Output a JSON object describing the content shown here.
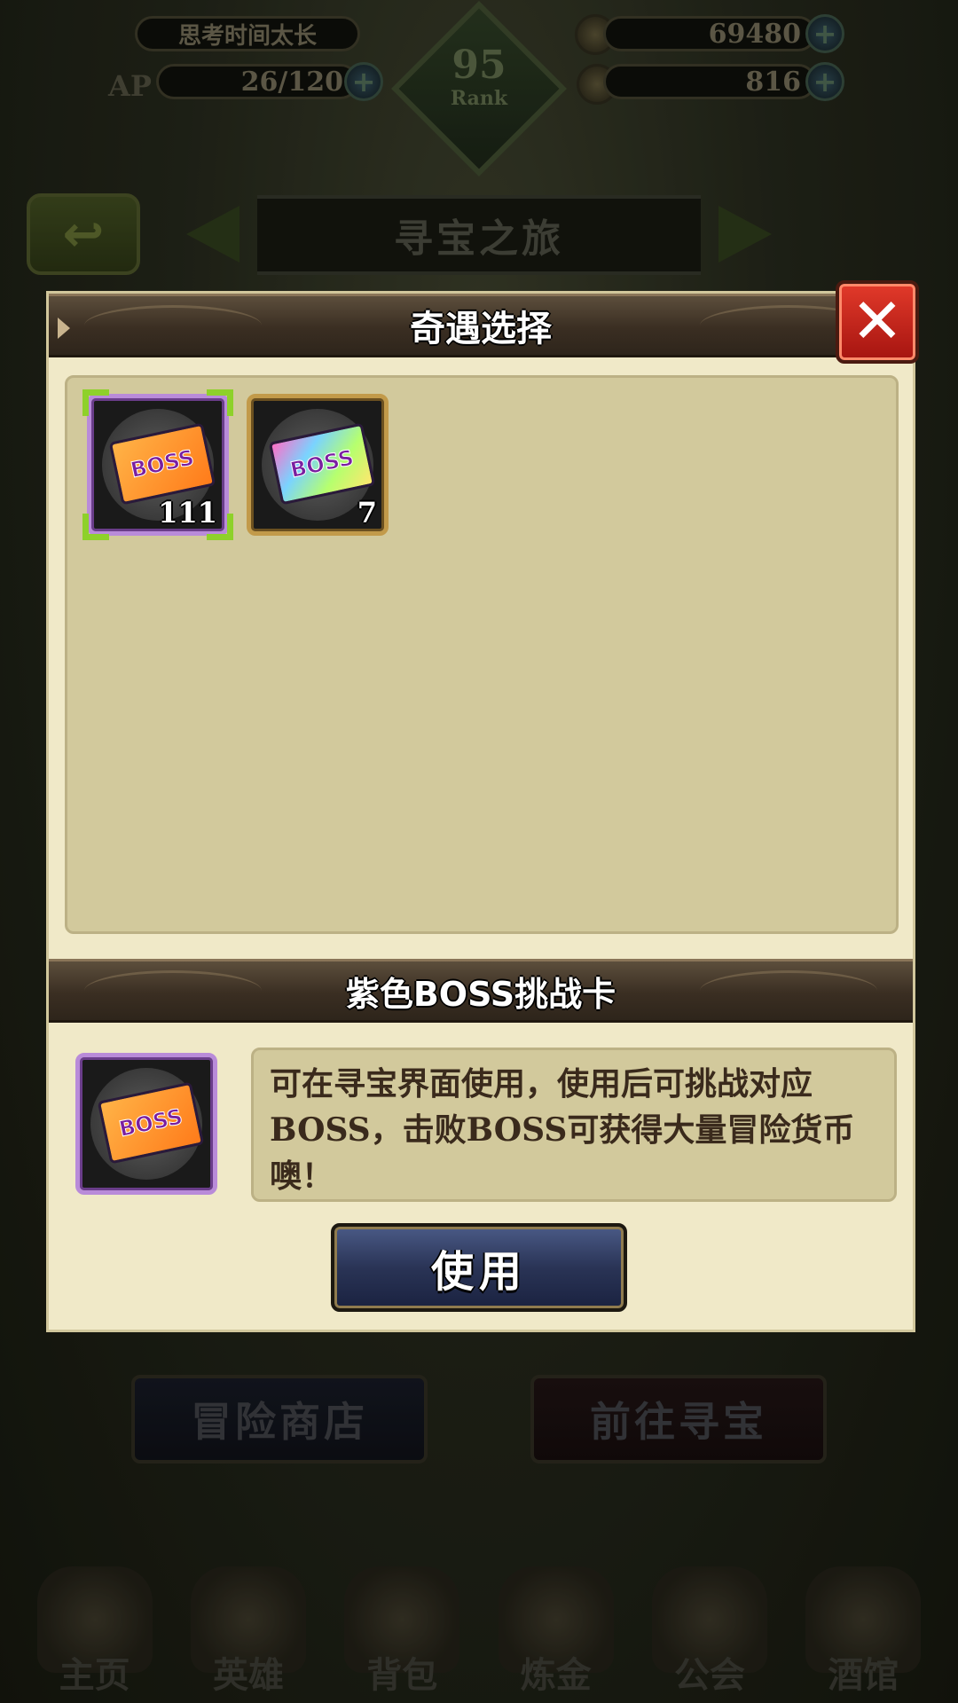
{
  "hud": {
    "status_text": "思考时间太长",
    "ap_label": "AP",
    "ap_value": "26/120",
    "rank_value": "95",
    "rank_label": "Rank",
    "gold_value": "69480",
    "feather_value": "816",
    "plus_symbol": "+"
  },
  "page": {
    "title": "寻宝之旅",
    "back_symbol": "↩"
  },
  "background_buttons": {
    "shop": "冒险商店",
    "go_treasure": "前往寻宝"
  },
  "bottom_nav": {
    "items": [
      {
        "label": "主页",
        "icon": "castle-icon"
      },
      {
        "label": "英雄",
        "icon": "helmet-icon"
      },
      {
        "label": "背包",
        "icon": "backpack-icon"
      },
      {
        "label": "炼金",
        "icon": "potion-icon"
      },
      {
        "label": "公会",
        "icon": "guild-shield-icon"
      },
      {
        "label": "酒馆",
        "icon": "tavern-icon"
      }
    ]
  },
  "dialog": {
    "title": "奇遇选择",
    "close_symbol": "✕",
    "items": [
      {
        "name": "purple-boss-card",
        "card_text": "BOSS",
        "count": "111",
        "frame": "purple",
        "selected": true
      },
      {
        "name": "rainbow-boss-card",
        "card_text": "BOSS",
        "count": "7",
        "frame": "gold",
        "selected": false
      }
    ],
    "selected_item": {
      "title": "紫色BOSS挑战卡",
      "card_text": "BOSS",
      "description": "可在寻宝界面使用，使用后可挑战对应BOSS，击败BOSS可获得大量冒险货币噢！"
    },
    "use_button": "使用"
  },
  "colors": {
    "dialog_bg": "#f0e9c8",
    "panel_bg": "#d2c99c",
    "header_bg": "#3a2e22",
    "close_red": "#c8201a",
    "use_button_blue": "#2a3456",
    "select_green": "#8ed12a"
  }
}
